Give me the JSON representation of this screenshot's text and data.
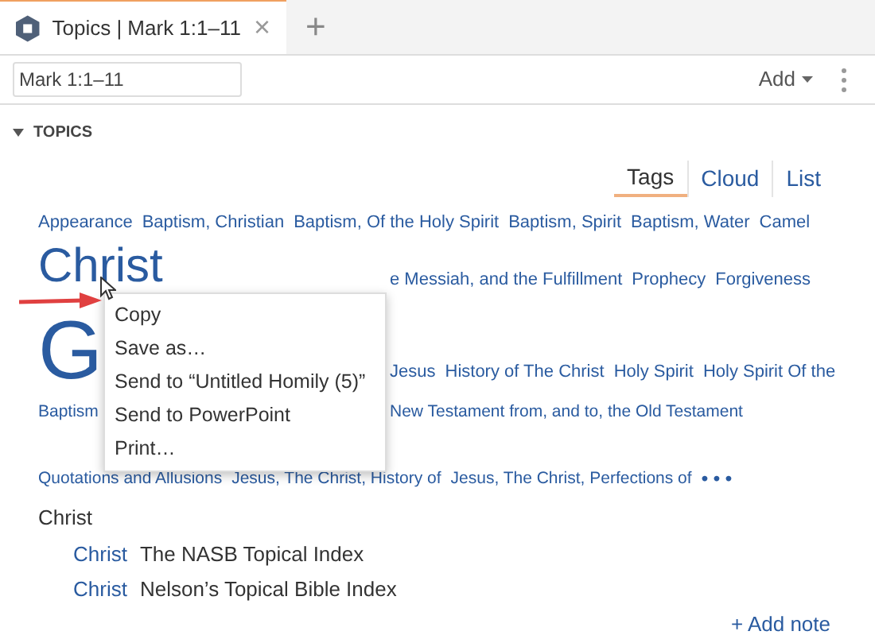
{
  "tab": {
    "title": "Topics | Mark 1:1–11",
    "close": "×",
    "new": "+"
  },
  "toolbar": {
    "reference": "Mark 1:1–11",
    "add": "Add"
  },
  "section": {
    "title": "TOPICS",
    "expanded": true
  },
  "views": [
    {
      "label": "Tags",
      "selected": true
    },
    {
      "label": "Cloud",
      "selected": false
    },
    {
      "label": "List",
      "selected": false
    }
  ],
  "cloud": [
    {
      "right": [
        {
          "text": "Appearance",
          "kind": "small"
        },
        {
          "text": "Baptism, Christian",
          "kind": "small"
        },
        {
          "text": "Baptism, Of the Holy Spirit",
          "kind": "small"
        },
        {
          "text": "Baptism, Spirit",
          "kind": "small"
        },
        {
          "text": "Baptism, Water",
          "kind": "small"
        },
        {
          "text": "Camel",
          "kind": "small"
        }
      ]
    },
    {
      "left": [
        {
          "text": "Christ",
          "kind": "large"
        }
      ],
      "right": [
        {
          "text": "e Messiah, and the Fulfillment",
          "kind": "small"
        },
        {
          "text": "Prophecy",
          "kind": "small"
        },
        {
          "text": "Forgiveness",
          "kind": "small"
        }
      ]
    },
    {
      "left": [
        {
          "text": "G",
          "kind": "huge"
        }
      ],
      "right": [
        {
          "text": "Jesus",
          "kind": "small"
        },
        {
          "text": "History of The Christ",
          "kind": "small"
        },
        {
          "text": "Holy Spirit",
          "kind": "small"
        },
        {
          "text": "Holy Spirit Of the",
          "kind": "small"
        }
      ]
    },
    {
      "left": [
        {
          "text": "Baptism",
          "kind": "tiny"
        }
      ],
      "right": [
        {
          "text": "New Testament from, and to, the Old Testament",
          "kind": "tiny"
        }
      ]
    },
    {
      "right": [
        {
          "text": "Quotations and Allusions",
          "kind": "tiny"
        },
        {
          "text": "Jesus, The Christ, History of",
          "kind": "tiny"
        },
        {
          "text": "Jesus, The Christ, Perfections of",
          "kind": "tiny"
        }
      ],
      "more": "• • •"
    }
  ],
  "entry": {
    "heading": "Christ",
    "rows": [
      {
        "link": "Christ",
        "source": "The NASB Topical Index"
      },
      {
        "link": "Christ",
        "source": "Nelson’s Topical Bible Index"
      }
    ],
    "add_note": "+ Add note"
  },
  "context_menu": [
    "Copy",
    "Save as…",
    "Send to “Untitled Homily (5)”",
    "Send to PowerPoint",
    "Print…"
  ]
}
